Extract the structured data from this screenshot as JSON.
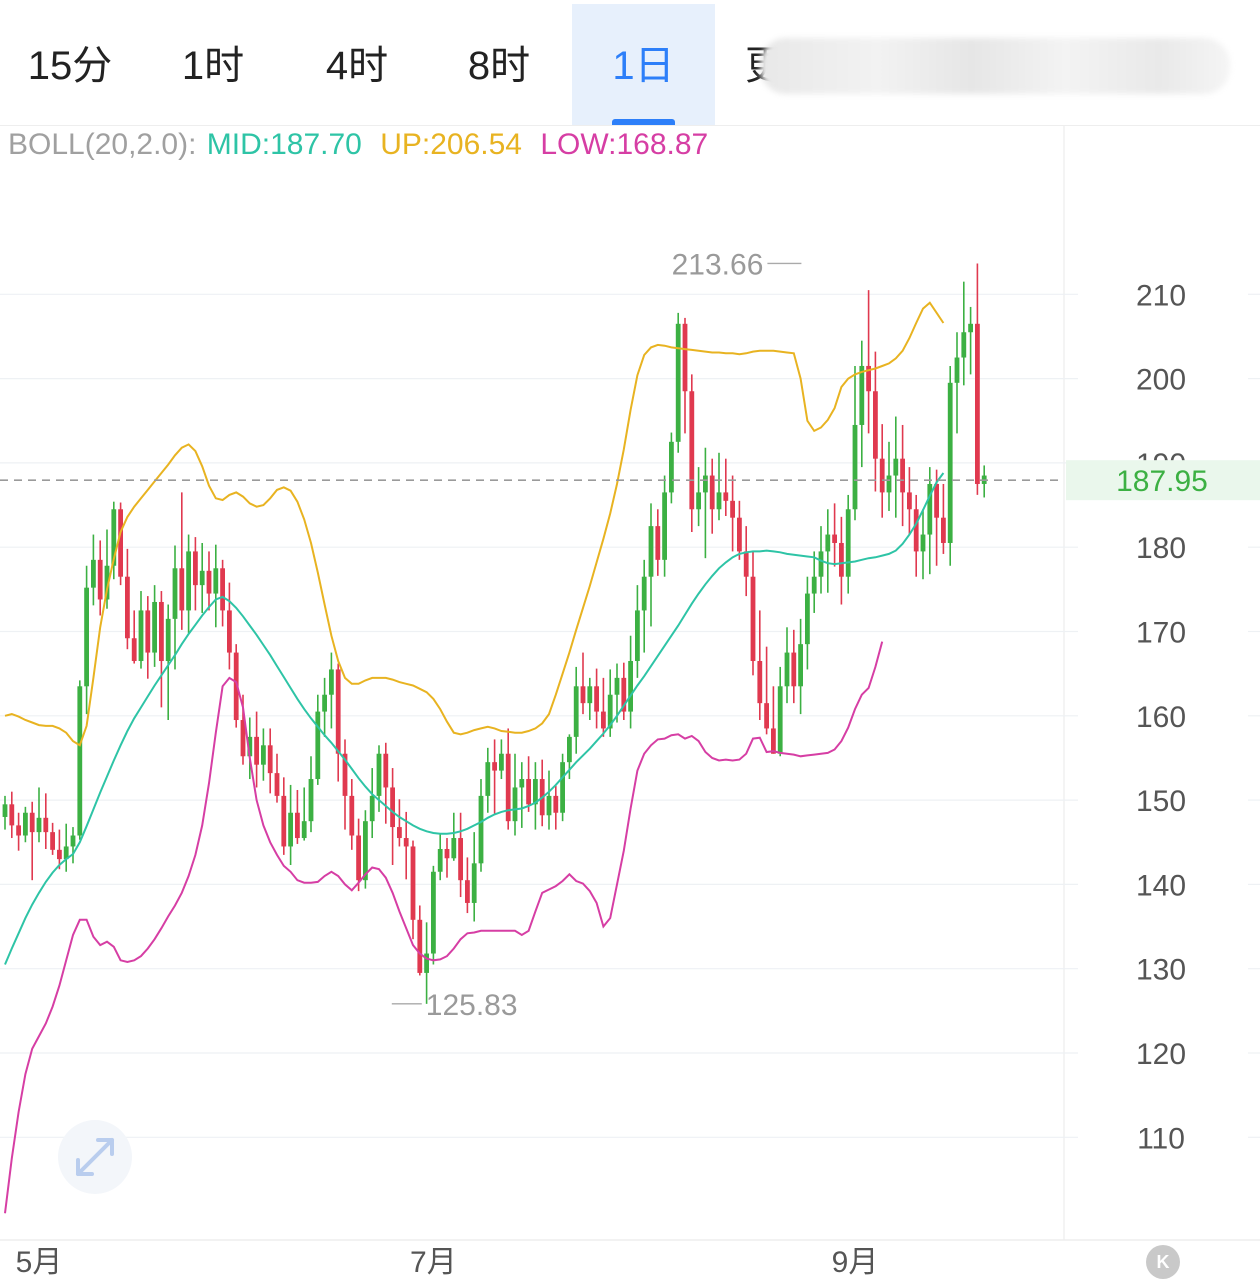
{
  "tabs": [
    {
      "label": "15分",
      "active": false
    },
    {
      "label": "1时",
      "active": false
    },
    {
      "label": "4时",
      "active": false
    },
    {
      "label": "8时",
      "active": false
    },
    {
      "label": "1日",
      "active": true
    },
    {
      "label": "更",
      "active": false
    }
  ],
  "indicator": {
    "label": "BOLL(20,2.0):",
    "mid": "MID:187.70",
    "up": "UP:206.54",
    "low": "LOW:168.87"
  },
  "colors": {
    "up_candle": "#3cb043",
    "down_candle": "#e0394f",
    "mid": "#2ec4a6",
    "upper": "#e8b321",
    "lower": "#d63ea4",
    "accent": "#2d7ff9"
  },
  "chart_data": {
    "type": "candlestick",
    "y_ticks": [
      210,
      200,
      190,
      180,
      170,
      160,
      150,
      140,
      130,
      120,
      110
    ],
    "x_labels": [
      {
        "label": "5月",
        "index": 5
      },
      {
        "label": "7月",
        "index": 63
      },
      {
        "label": "9月",
        "index": 125
      }
    ],
    "ylim": [
      100,
      220
    ],
    "current_price": "187.95",
    "current_price_value": 187.95,
    "high_label": "213.66",
    "high_value": 213.66,
    "high_index": 118,
    "low_label": "125.83",
    "low_value": 125.83,
    "low_index": 56,
    "candles": [
      [
        148.0,
        149.5,
        150.5,
        146.5
      ],
      [
        149.5,
        147.0,
        151.0,
        145.5
      ],
      [
        147.0,
        145.8,
        148.5,
        144.0
      ],
      [
        145.8,
        148.5,
        149.2,
        145.0
      ],
      [
        148.5,
        146.2,
        149.8,
        140.5
      ],
      [
        146.2,
        147.9,
        151.5,
        145.0
      ],
      [
        147.9,
        146.2,
        150.8,
        144.2
      ],
      [
        146.2,
        144.1,
        147.3,
        143.5
      ],
      [
        144.1,
        143.0,
        146.5,
        141.8
      ],
      [
        143.0,
        144.5,
        147.2,
        141.5
      ],
      [
        144.5,
        145.8,
        146.8,
        142.5
      ],
      [
        145.8,
        163.5,
        164.2,
        145.3
      ],
      [
        163.5,
        175.2,
        177.8,
        160.2
      ],
      [
        175.2,
        178.5,
        181.5,
        173.1
      ],
      [
        178.5,
        173.8,
        180.8,
        171.9
      ],
      [
        173.8,
        177.8,
        182.1,
        172.7
      ],
      [
        177.8,
        184.5,
        185.4,
        176.2
      ],
      [
        184.5,
        176.5,
        185.3,
        175.5
      ],
      [
        176.5,
        169.2,
        179.8,
        167.9
      ],
      [
        169.2,
        166.5,
        172.5,
        166.2
      ],
      [
        166.5,
        172.5,
        174.8,
        165.6
      ],
      [
        172.5,
        167.5,
        174.2,
        164.4
      ],
      [
        167.5,
        173.5,
        175.5,
        165.8
      ],
      [
        173.5,
        166.5,
        174.8,
        161.0
      ],
      [
        166.5,
        171.5,
        173.2,
        159.5
      ],
      [
        171.5,
        177.5,
        180.2,
        165.5
      ],
      [
        177.5,
        172.5,
        186.5,
        170.2
      ],
      [
        172.5,
        179.5,
        181.5,
        169.8
      ],
      [
        179.5,
        175.5,
        181.2,
        172.5
      ],
      [
        175.5,
        177.2,
        180.5,
        172.2
      ],
      [
        177.2,
        174.5,
        179.5,
        172.5
      ],
      [
        174.5,
        177.5,
        180.3,
        170.5
      ],
      [
        177.5,
        172.5,
        178.5,
        170.6
      ],
      [
        172.5,
        167.5,
        175.8,
        165.5
      ],
      [
        167.5,
        159.5,
        168.5,
        158.6
      ],
      [
        159.5,
        155.2,
        162.5,
        154.2
      ],
      [
        155.2,
        157.5,
        159.8,
        152.5
      ],
      [
        157.5,
        154.2,
        160.5,
        151.5
      ],
      [
        154.2,
        156.5,
        158.5,
        152.3
      ],
      [
        156.5,
        153.2,
        158.5,
        150.8
      ],
      [
        153.2,
        150.5,
        155.5,
        149.7
      ],
      [
        150.5,
        144.5,
        152.7,
        143.5
      ],
      [
        144.5,
        148.5,
        151.8,
        142.3
      ],
      [
        148.5,
        145.5,
        151.2,
        144.8
      ],
      [
        145.5,
        147.5,
        151.5,
        145.2
      ],
      [
        147.5,
        152.5,
        155.2,
        146.2
      ],
      [
        152.5,
        160.5,
        162.5,
        151.8
      ],
      [
        160.5,
        162.5,
        164.5,
        157.5
      ],
      [
        162.5,
        165.5,
        167.5,
        158.5
      ],
      [
        165.5,
        155.5,
        166.2,
        152.2
      ],
      [
        155.5,
        150.5,
        157.2,
        146.5
      ],
      [
        150.5,
        145.8,
        152.5,
        144.1
      ],
      [
        145.8,
        140.5,
        147.8,
        139.2
      ],
      [
        140.5,
        147.5,
        148.8,
        139.5
      ],
      [
        147.5,
        150.5,
        153.8,
        145.5
      ],
      [
        150.5,
        155.5,
        156.5,
        148.6
      ],
      [
        155.5,
        151.5,
        156.8,
        147.2
      ],
      [
        151.5,
        146.8,
        153.8,
        142.3
      ],
      [
        146.8,
        145.5,
        150.1,
        144.5
      ],
      [
        145.5,
        144.5,
        148.6,
        140.6
      ],
      [
        144.5,
        135.8,
        145.2,
        133.5
      ],
      [
        135.8,
        129.5,
        137.5,
        129.2
      ],
      [
        129.5,
        131.8,
        135.5,
        125.83
      ],
      [
        131.8,
        141.5,
        142.2,
        130.5
      ],
      [
        141.5,
        144.2,
        146.1,
        140.5
      ],
      [
        144.2,
        143.1,
        145.5,
        140.8
      ],
      [
        143.1,
        145.5,
        148.5,
        142.8
      ],
      [
        145.5,
        140.5,
        148.5,
        138.5
      ],
      [
        140.5,
        137.8,
        143.2,
        136.6
      ],
      [
        137.8,
        142.5,
        146.2,
        135.6
      ],
      [
        142.5,
        150.5,
        152.5,
        141.5
      ],
      [
        150.5,
        154.5,
        156.2,
        148.5
      ],
      [
        154.5,
        153.5,
        157.2,
        148.4
      ],
      [
        153.5,
        155.5,
        157.2,
        152.5
      ],
      [
        155.5,
        147.5,
        158.5,
        146.5
      ],
      [
        147.5,
        151.5,
        155.5,
        145.8
      ],
      [
        151.5,
        152.5,
        154.5,
        146.7
      ],
      [
        152.5,
        149.5,
        155.2,
        148.6
      ],
      [
        149.5,
        152.5,
        154.5,
        146.5
      ],
      [
        152.5,
        148.2,
        154.8,
        146.9
      ],
      [
        148.2,
        150.5,
        153.5,
        146.5
      ],
      [
        150.5,
        148.5,
        151.7,
        146.5
      ],
      [
        148.5,
        154.5,
        155.5,
        147.5
      ],
      [
        154.5,
        157.5,
        157.8,
        152.5
      ],
      [
        157.5,
        163.5,
        165.8,
        155.5
      ],
      [
        163.5,
        161.5,
        167.5,
        160.2
      ],
      [
        161.5,
        163.5,
        164.5,
        159.5
      ],
      [
        163.5,
        160.5,
        165.6,
        158.5
      ],
      [
        160.5,
        158.5,
        164.5,
        157.5
      ],
      [
        158.5,
        162.5,
        165.5,
        157.5
      ],
      [
        162.5,
        164.5,
        166.2,
        159.2
      ],
      [
        164.5,
        160.5,
        166.3,
        159.5
      ],
      [
        160.5,
        166.5,
        169.5,
        158.5
      ],
      [
        166.5,
        172.5,
        175.5,
        164.5
      ],
      [
        172.5,
        176.5,
        178.5,
        167.5
      ],
      [
        176.5,
        182.5,
        185.2,
        170.6
      ],
      [
        182.5,
        178.5,
        184.5,
        176.6
      ],
      [
        178.5,
        186.5,
        188.5,
        176.5
      ],
      [
        186.5,
        192.5,
        193.6,
        185.2
      ],
      [
        192.5,
        206.5,
        207.8,
        191.2
      ],
      [
        206.5,
        198.5,
        207.2,
        193.5
      ],
      [
        198.5,
        184.5,
        200.5,
        181.8
      ],
      [
        184.5,
        186.5,
        189.5,
        182.5
      ],
      [
        186.5,
        188.5,
        191.8,
        178.7
      ],
      [
        188.5,
        184.5,
        190.5,
        181.6
      ],
      [
        184.5,
        186.5,
        191.2,
        183.2
      ],
      [
        186.5,
        185.5,
        190.5,
        183.7
      ],
      [
        185.5,
        183.5,
        188.5,
        179.5
      ],
      [
        183.5,
        179.5,
        185.5,
        178.5
      ],
      [
        179.5,
        176.5,
        182.5,
        174.2
      ],
      [
        176.5,
        166.5,
        179.5,
        164.8
      ],
      [
        166.5,
        161.5,
        172.5,
        159.5
      ],
      [
        161.5,
        158.5,
        168.2,
        157.8
      ],
      [
        158.5,
        155.5,
        163.5,
        155.5
      ],
      [
        155.5,
        163.5,
        165.8,
        155.2
      ],
      [
        163.5,
        167.5,
        170.5,
        161.5
      ],
      [
        167.5,
        163.5,
        170.2,
        161.5
      ],
      [
        163.5,
        168.5,
        171.5,
        160.2
      ],
      [
        168.5,
        174.5,
        176.5,
        165.5
      ],
      [
        174.5,
        176.5,
        179.5,
        172.2
      ],
      [
        176.5,
        179.5,
        182.5,
        174.5
      ],
      [
        179.5,
        181.5,
        184.5,
        174.6
      ],
      [
        181.5,
        180.5,
        185.2,
        177.7
      ],
      [
        180.5,
        176.5,
        183.6,
        173.2
      ],
      [
        176.5,
        184.5,
        186.2,
        174.5
      ],
      [
        184.5,
        194.5,
        201.5,
        183.2
      ],
      [
        194.5,
        201.5,
        204.5,
        189.5
      ],
      [
        201.5,
        198.5,
        210.5,
        193.5
      ],
      [
        198.5,
        190.5,
        203.2,
        186.6
      ],
      [
        190.5,
        186.5,
        194.6,
        183.5
      ],
      [
        186.5,
        188.5,
        192.5,
        184.3
      ],
      [
        188.5,
        190.5,
        195.5,
        183.5
      ],
      [
        190.5,
        186.5,
        194.5,
        182.5
      ],
      [
        186.5,
        184.5,
        189.5,
        181.5
      ],
      [
        184.5,
        179.5,
        186.2,
        176.5
      ],
      [
        179.5,
        181.5,
        184.5,
        176.2
      ],
      [
        181.5,
        187.5,
        189.5,
        176.8
      ],
      [
        187.5,
        183.5,
        189.2,
        177.8
      ],
      [
        183.5,
        180.5,
        187.5,
        179.2
      ],
      [
        180.5,
        199.5,
        201.5,
        177.8
      ],
      [
        199.5,
        202.5,
        205.5,
        193.5
      ],
      [
        202.5,
        205.5,
        211.5,
        199.2
      ],
      [
        205.5,
        206.5,
        208.5,
        200.5
      ],
      [
        206.5,
        187.5,
        213.66,
        186.2
      ],
      [
        187.5,
        188.5,
        189.7,
        185.9
      ]
    ],
    "mid_band": [
      130.5,
      132.4,
      134.2,
      136.0,
      137.6,
      139.0,
      140.3,
      141.4,
      142.3,
      143.0,
      143.6,
      145.0,
      146.9,
      148.9,
      150.9,
      152.8,
      154.7,
      156.5,
      158.2,
      159.7,
      161.0,
      162.3,
      163.6,
      164.8,
      166.0,
      167.2,
      168.5,
      169.7,
      170.8,
      171.9,
      172.9,
      173.8,
      174.1,
      173.6,
      172.8,
      171.8,
      170.7,
      169.6,
      168.4,
      167.2,
      165.9,
      164.6,
      163.3,
      162.0,
      160.8,
      159.7,
      158.7,
      157.7,
      156.8,
      155.8,
      154.8,
      153.7,
      152.6,
      151.6,
      150.7,
      150.0,
      149.3,
      148.6,
      148.0,
      147.5,
      147.0,
      146.6,
      146.3,
      146.1,
      146.0,
      146.0,
      146.1,
      146.3,
      146.6,
      147.0,
      147.4,
      147.9,
      148.3,
      148.6,
      148.8,
      148.9,
      149.0,
      149.3,
      149.7,
      150.3,
      151.0,
      151.8,
      152.7,
      153.6,
      154.5,
      155.3,
      156.1,
      157.0,
      157.9,
      158.9,
      160.0,
      161.2,
      162.4,
      163.6,
      164.7,
      165.9,
      167.1,
      168.3,
      169.5,
      170.7,
      172.0,
      173.3,
      174.5,
      175.6,
      176.6,
      177.5,
      178.2,
      178.8,
      179.2,
      179.4,
      179.5,
      179.5,
      179.6,
      179.5,
      179.4,
      179.2,
      179.1,
      179.0,
      178.9,
      178.8,
      178.4,
      178.1,
      178.0,
      178.1,
      178.2,
      178.3,
      178.5,
      178.7,
      178.8,
      179.0,
      179.2,
      179.6,
      180.4,
      181.5,
      182.8,
      184.4,
      186.1,
      187.7,
      188.8
    ],
    "upper_band": [
      160.0,
      160.2,
      159.9,
      159.5,
      159.2,
      158.9,
      158.8,
      158.8,
      158.5,
      158.0,
      157.0,
      156.5,
      158.8,
      164.5,
      170.5,
      175.0,
      178.6,
      181.8,
      183.6,
      184.8,
      185.8,
      186.8,
      187.8,
      188.8,
      189.8,
      190.9,
      191.8,
      192.2,
      191.4,
      189.6,
      187.3,
      185.8,
      185.6,
      186.2,
      186.5,
      186.0,
      185.2,
      184.8,
      185.0,
      185.8,
      186.8,
      187.1,
      186.7,
      185.4,
      183.3,
      180.5,
      177.0,
      173.2,
      169.5,
      166.5,
      164.5,
      163.8,
      163.8,
      164.2,
      164.5,
      164.5,
      164.5,
      164.3,
      164.0,
      163.8,
      163.6,
      163.2,
      162.8,
      162.0,
      160.8,
      159.3,
      158.0,
      157.8,
      158.0,
      158.3,
      158.5,
      158.7,
      158.5,
      158.2,
      158.1,
      158.0,
      158.0,
      158.2,
      158.5,
      159.1,
      160.2,
      162.5,
      165.0,
      167.5,
      170.2,
      172.8,
      175.4,
      178.2,
      181.0,
      184.0,
      187.5,
      191.6,
      196.3,
      200.4,
      202.8,
      203.7,
      204.0,
      203.9,
      203.7,
      203.6,
      203.5,
      203.4,
      203.3,
      203.2,
      203.1,
      203.1,
      203.0,
      203.0,
      202.9,
      203.0,
      203.2,
      203.3,
      203.3,
      203.3,
      203.2,
      203.1,
      203.0,
      200.0,
      195.0,
      193.8,
      194.2,
      195.1,
      196.5,
      199.0,
      200.0,
      200.5,
      200.8,
      201.0,
      201.2,
      201.5,
      201.8,
      202.4,
      203.3,
      204.8,
      206.6,
      208.3,
      209.0,
      207.8,
      206.6
    ],
    "lower_band": [
      101.0,
      107.5,
      113.0,
      117.5,
      120.5,
      122.0,
      123.5,
      125.5,
      128.0,
      131.0,
      134.0,
      135.8,
      135.8,
      133.8,
      132.8,
      133.2,
      132.6,
      131.0,
      130.8,
      131.0,
      131.5,
      132.4,
      133.5,
      134.8,
      136.2,
      137.5,
      139.0,
      141.0,
      143.5,
      147.0,
      152.0,
      158.0,
      163.5,
      164.5,
      164.0,
      161.0,
      155.0,
      150.0,
      147.0,
      145.0,
      143.5,
      142.2,
      141.5,
      140.5,
      140.2,
      140.2,
      140.3,
      141.0,
      141.5,
      141.0,
      140.0,
      139.3,
      140.2,
      141.2,
      142.0,
      141.8,
      140.8,
      139.0,
      136.8,
      134.8,
      132.8,
      131.8,
      131.2,
      131.0,
      131.1,
      131.5,
      132.4,
      133.5,
      134.2,
      134.3,
      134.5,
      134.5,
      134.5,
      134.5,
      134.5,
      134.5,
      134.0,
      134.5,
      136.8,
      139.0,
      139.4,
      139.8,
      140.4,
      141.2,
      140.4,
      140.1,
      139.2,
      137.8,
      135.0,
      136.0,
      140.0,
      144.0,
      149.0,
      153.5,
      155.5,
      156.5,
      157.2,
      157.3,
      157.7,
      157.8,
      157.3,
      157.6,
      157.0,
      155.7,
      155.0,
      154.7,
      154.8,
      154.7,
      154.8,
      155.5,
      157.3,
      157.4,
      155.7,
      155.8,
      155.6,
      155.5,
      155.4,
      155.2,
      155.3,
      155.4,
      155.5,
      155.6,
      156.0,
      157.0,
      158.6,
      160.8,
      162.5,
      163.3,
      165.8,
      168.8
    ]
  }
}
